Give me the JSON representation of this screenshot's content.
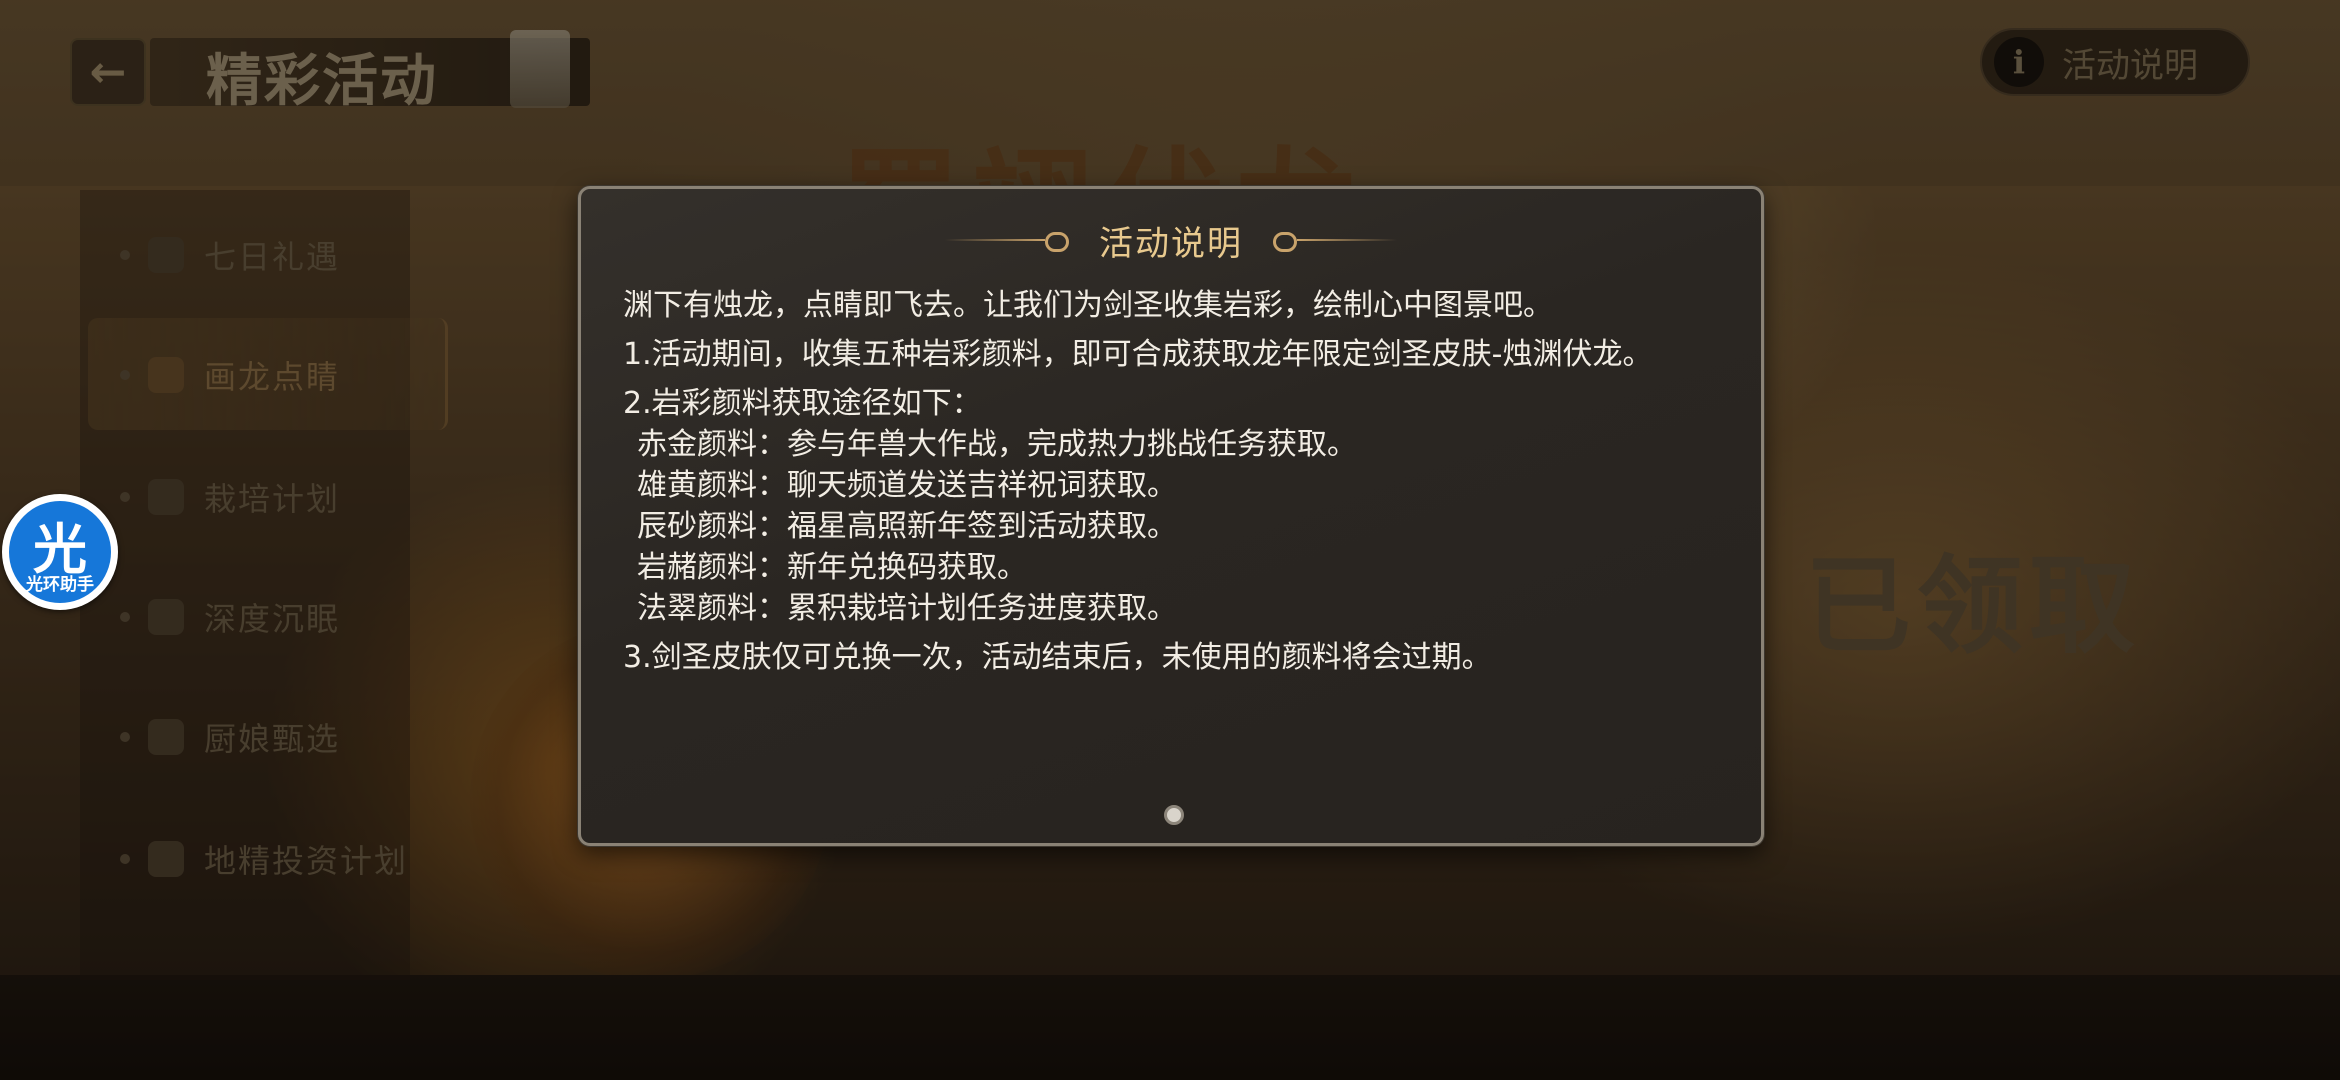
{
  "header": {
    "back_icon": "←",
    "title": "精彩活动",
    "info_icon": "i",
    "info_label": "活动说明"
  },
  "background": {
    "calligraphy": "蜀翊伏龙",
    "claimed_stamp": "已领取"
  },
  "sidebar": {
    "items": [
      {
        "label": "七日礼遇",
        "active": false
      },
      {
        "label": "画龙点睛",
        "active": true
      },
      {
        "label": "栽培计划",
        "active": false
      },
      {
        "label": "深度沉眠",
        "active": false
      },
      {
        "label": "厨娘甄选",
        "active": false
      },
      {
        "label": "地精投资计划",
        "active": false
      }
    ]
  },
  "assistant": {
    "glyph": "光",
    "caption": "光环助手"
  },
  "modal": {
    "title": "活动说明",
    "intro": "渊下有烛龙，点睛即飞去。让我们为剑圣收集岩彩，绘制心中图景吧。",
    "rule1": "1.活动期间，收集五种岩彩颜料，即可合成获取龙年限定剑圣皮肤-烛渊伏龙。",
    "rule2": "2.岩彩颜料获取途径如下：",
    "sources": [
      "赤金颜料：参与年兽大作战，完成热力挑战任务获取。",
      "雄黄颜料：聊天频道发送吉祥祝词获取。",
      "辰砂颜料：福星高照新年签到活动获取。",
      "岩赭颜料：新年兑换码获取。",
      "法翠颜料：累积栽培计划任务进度获取。"
    ],
    "rule3": "3.剑圣皮肤仅可兑换一次，活动结束后，未使用的颜料将会过期。",
    "page_indicator": {
      "current": 1,
      "total": 1
    }
  }
}
